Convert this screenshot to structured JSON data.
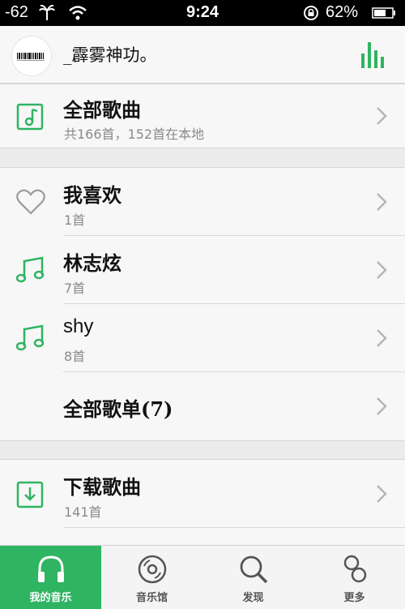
{
  "status_bar": {
    "signal": "-62",
    "time": "9:24",
    "battery": "62%"
  },
  "header": {
    "title": "_霹雾神功。"
  },
  "all_songs": {
    "title": "全部歌曲",
    "subtitle": "共166首，152首在本地"
  },
  "playlists": [
    {
      "title": "我喜欢",
      "subtitle": "1首",
      "icon": "heart-icon"
    },
    {
      "title": "林志炫",
      "subtitle": "7首",
      "icon": "music-note-icon"
    },
    {
      "title": "shy",
      "subtitle": "8首",
      "icon": "music-note-icon"
    }
  ],
  "all_playlists": {
    "title": "全部歌单(7)"
  },
  "downloads": {
    "title": "下载歌曲",
    "subtitle": "141首"
  },
  "tabs": [
    {
      "label": "我的音乐",
      "icon": "headphones-icon",
      "active": true
    },
    {
      "label": "音乐馆",
      "icon": "disc-icon",
      "active": false
    },
    {
      "label": "发现",
      "icon": "search-icon",
      "active": false
    },
    {
      "label": "更多",
      "icon": "more-icon",
      "active": false
    }
  ],
  "colors": {
    "accent": "#2fb462",
    "background": "#ececec",
    "row_background": "#f7f7f7",
    "subtitle": "#8a8a8a"
  }
}
